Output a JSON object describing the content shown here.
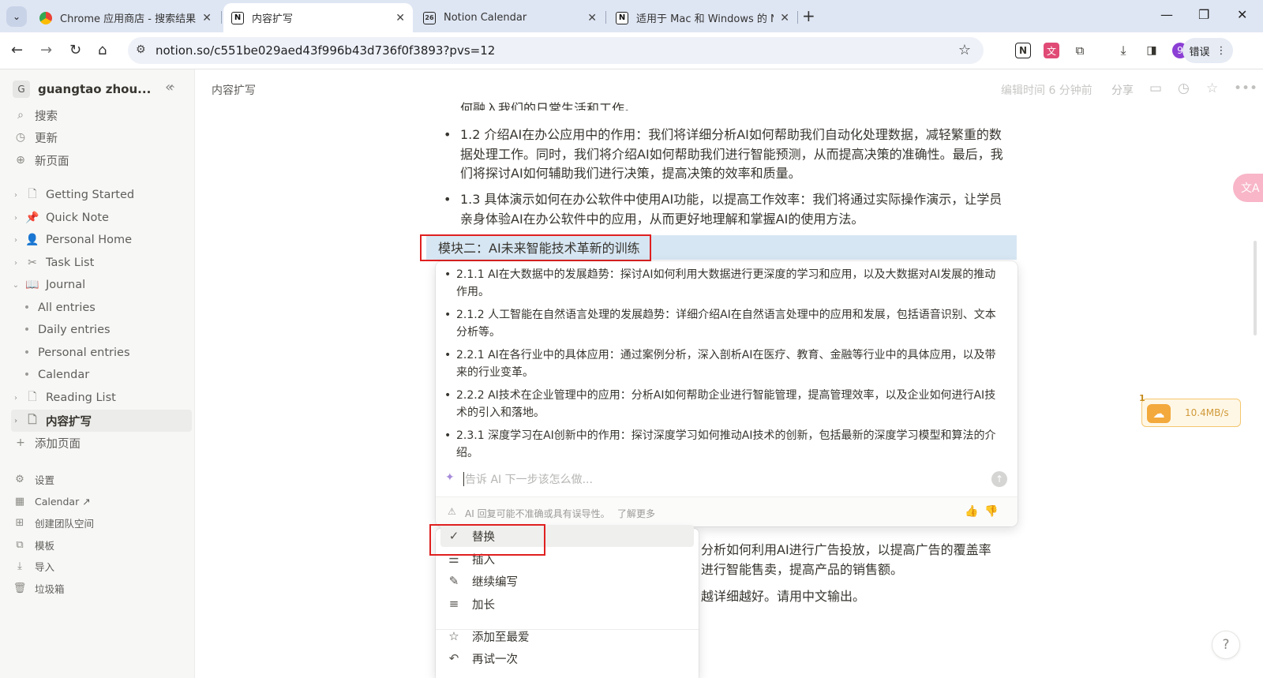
{
  "browser": {
    "tabs": [
      {
        "title": "Chrome 应用商店 - 搜索结果",
        "favicon": "chrome-web-store-icon"
      },
      {
        "title": "内容扩写",
        "favicon": "notion-icon"
      },
      {
        "title": "Notion Calendar",
        "favicon": "notion-calendar-icon",
        "favicon_text": "26"
      },
      {
        "title": "适用于 Mac 和 Windows 的 N",
        "favicon": "notion-icon"
      }
    ],
    "url": "notion.so/c551be029aed43f996b43d736f0f3893?pvs=12",
    "profile_initial": "9",
    "error_label": "错误"
  },
  "sidebar": {
    "workspace_initial": "G",
    "workspace_name": "guangtao zhou...",
    "nav": [
      "搜索",
      "更新",
      "新页面"
    ],
    "pages": [
      {
        "label": "Getting Started",
        "icon": "page-icon"
      },
      {
        "label": "Quick Note",
        "icon": "pin-icon"
      },
      {
        "label": "Personal Home",
        "icon": "person-icon"
      },
      {
        "label": "Task List",
        "icon": "scissors-icon"
      },
      {
        "label": "Journal",
        "icon": "book-icon"
      }
    ],
    "journal_children": [
      "All entries",
      "Daily entries",
      "Personal entries",
      "Calendar"
    ],
    "pages_after": [
      {
        "label": "Reading List",
        "icon": "page-icon"
      },
      {
        "label": "内容扩写",
        "icon": "page-icon"
      }
    ],
    "add_page": "添加页面",
    "bottom": [
      "设置",
      "Calendar ↗",
      "创建团队空间",
      "模板",
      "导入",
      "垃圾箱"
    ]
  },
  "topbar": {
    "breadcrumb": "内容扩写",
    "edited": "编辑时间 6 分钟前",
    "share": "分享"
  },
  "content": {
    "cut_line": "何融入我们的日常生活和工作。",
    "bullets": [
      "1.2 介绍AI在办公应用中的作用：我们将详细分析AI如何帮助我们自动化处理数据，减轻繁重的数据处理工作。同时，我们将介绍AI如何帮助我们进行智能预测，从而提高决策的准确性。最后，我们将探讨AI如何辅助我们进行决策，提高决策的效率和质量。",
      "1.3 具体演示如何在办公软件中使用AI功能，以提高工作效率：我们将通过实际操作演示，让学员亲身体验AI在办公软件中的应用，从而更好地理解和掌握AI的使用方法。"
    ],
    "module_heading": "模块二：AI未来智能技术革新的训练",
    "behind_text": [
      "分析如何利用AI进行广告投放，以提高广告的覆盖率",
      "进行智能售卖，提高产品的销售额。",
      "越详细越好。请用中文输出。"
    ]
  },
  "ai_panel": {
    "items": [
      "2.1.1 AI在大数据中的发展趋势：探讨AI如何利用大数据进行更深度的学习和应用，以及大数据对AI发展的推动作用。",
      "2.1.2 人工智能在自然语言处理的发展趋势：详细介绍AI在自然语言处理中的应用和发展，包括语音识别、文本分析等。",
      "2.2.1 AI在各行业中的具体应用：通过案例分析，深入剖析AI在医疗、教育、金融等行业中的具体应用，以及带来的行业变革。",
      "2.2.2 AI技术在企业管理中的应用：分析AI如何帮助企业进行智能管理，提高管理效率，以及企业如何进行AI技术的引入和落地。",
      "2.3.1 深度学习在AI创新中的作用：探讨深度学习如何推动AI技术的创新，包括最新的深度学习模型和算法的介绍。"
    ],
    "input_placeholder": "告诉 AI 下一步该怎么做...",
    "disclaimer": "AI 回复可能不准确或具有误导性。",
    "learn_more": "了解更多"
  },
  "menu": {
    "items": [
      {
        "label": "替换",
        "icon": "check-icon",
        "selected": true
      },
      {
        "label": "插入",
        "icon": "insert-lines-icon"
      },
      {
        "label": "继续编写",
        "icon": "pen-icon"
      },
      {
        "label": "加长",
        "icon": "lines-icon"
      }
    ],
    "items2": [
      {
        "label": "添加至最爱",
        "icon": "star-icon"
      },
      {
        "label": "再试一次",
        "icon": "undo-icon"
      }
    ]
  },
  "widgets": {
    "net_badge": "1",
    "net_speed": "10.4MB/s",
    "help": "?",
    "translate": "文A"
  },
  "colors": {
    "highlight": "#d7e6f3",
    "annotation_red": "#e02020",
    "sidebar_bg": "#f7f7f5",
    "tabstrip_bg": "#dfe6f3"
  }
}
